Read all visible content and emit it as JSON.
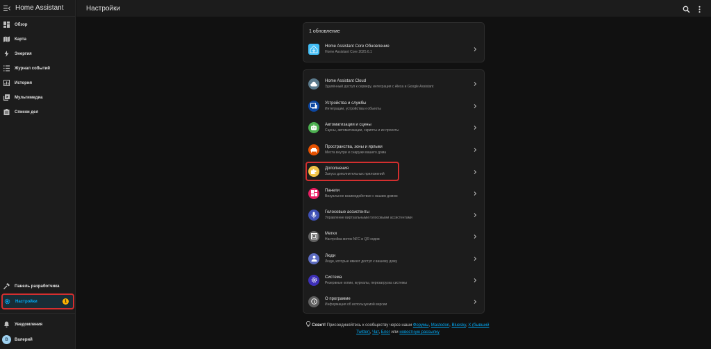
{
  "app": {
    "title": "Home Assistant"
  },
  "header": {
    "title": "Настройки"
  },
  "sidebar": {
    "items": [
      {
        "label": "Обзор"
      },
      {
        "label": "Карта"
      },
      {
        "label": "Энергия"
      },
      {
        "label": "Журнал событий"
      },
      {
        "label": "История"
      },
      {
        "label": "Мультимедиа"
      },
      {
        "label": "Списки дел"
      }
    ],
    "developer": "Панель разработчика",
    "settings": "Настройки",
    "settings_badge": "1",
    "notifications": "Уведомления",
    "user_name": "Валерий",
    "user_initial": "В"
  },
  "updates": {
    "heading": "1 обновление",
    "item": {
      "title": "Home Assistant Core Обновление",
      "subtitle": "Home Assistant Core 2025.6.1"
    }
  },
  "settings_list": [
    {
      "title": "Home Assistant Cloud",
      "subtitle": "Удалённый доступ к серверу, интеграция с Alexa и Google Assistant",
      "color": "#5b7a8c"
    },
    {
      "title": "Устройства и службы",
      "subtitle": "Интеграции, устройства и объекты",
      "color": "#0d47a1"
    },
    {
      "title": "Автоматизации и сцены",
      "subtitle": "Сцены, автоматизации, скрипты и их проекты",
      "color": "#4caf50"
    },
    {
      "title": "Пространства, зоны и ярлыки",
      "subtitle": "Места внутри и снаружи вашего дома",
      "color": "#e65100"
    },
    {
      "title": "Дополнения",
      "subtitle": "Запуск дополнительных приложений",
      "color": "#f1c447"
    },
    {
      "title": "Панели",
      "subtitle": "Визуальное взаимодействие с вашим домом",
      "color": "#e91e63"
    },
    {
      "title": "Голосовые ассистенты",
      "subtitle": "Управление виртуальными голосовыми ассистентами",
      "color": "#3f51b5"
    },
    {
      "title": "Метки",
      "subtitle": "Настройка меток NFC и QR кодов",
      "color": "#616161"
    },
    {
      "title": "Люди",
      "subtitle": "Люди, которые имеют доступ к вашему дому",
      "color": "#5c6bc0"
    },
    {
      "title": "Система",
      "subtitle": "Резервные копии, журналы, перезагрузка системы",
      "color": "#3d2fb7"
    },
    {
      "title": "О программе",
      "subtitle": "Информация об используемой версии",
      "color": "#5f5f5f"
    }
  ],
  "footer": {
    "tip_label": "Совет!",
    "text": "Присоединяйтесь к сообществу через наши",
    "links": [
      "Форумы",
      "Mastodon",
      "Bluesky",
      "X (бывший Twitter)",
      "Чат",
      "Блог"
    ],
    "or": "или",
    "newsletter": "новостную рассылку"
  }
}
